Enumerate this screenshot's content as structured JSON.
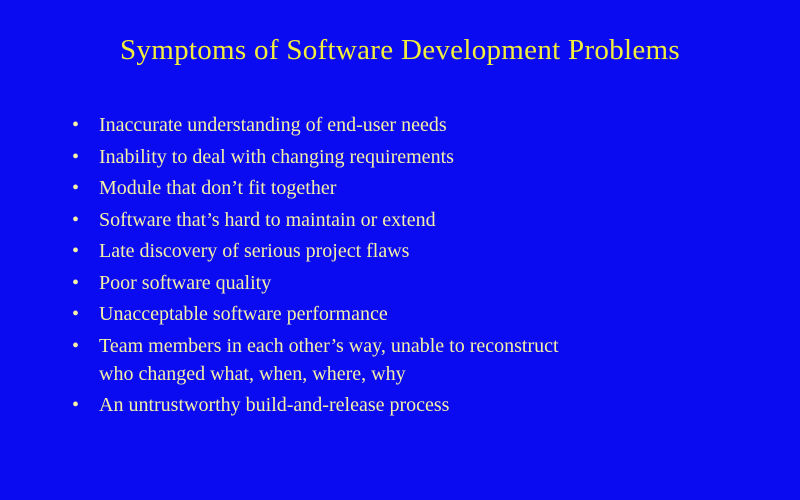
{
  "slide": {
    "title": "Symptoms of Software Development Problems",
    "bullet_glyph": "•",
    "bullets": [
      {
        "lines": [
          "Inaccurate understanding of end-user needs"
        ]
      },
      {
        "lines": [
          "Inability to deal with changing requirements"
        ]
      },
      {
        "lines": [
          "Module that don’t fit together"
        ]
      },
      {
        "lines": [
          "Software that’s hard to maintain or extend"
        ]
      },
      {
        "lines": [
          "Late discovery of serious project flaws"
        ]
      },
      {
        "lines": [
          "Poor software quality"
        ]
      },
      {
        "lines": [
          "Unacceptable software performance"
        ]
      },
      {
        "lines": [
          "Team members in each other’s way, unable to reconstruct",
          "who changed what, when, where, why"
        ]
      },
      {
        "lines": [
          "An untrustworthy build-and-release process"
        ]
      }
    ],
    "colors": {
      "background": "#0b0bf1",
      "title": "#f2ee3a",
      "body_text": "#f4f0a8"
    }
  }
}
